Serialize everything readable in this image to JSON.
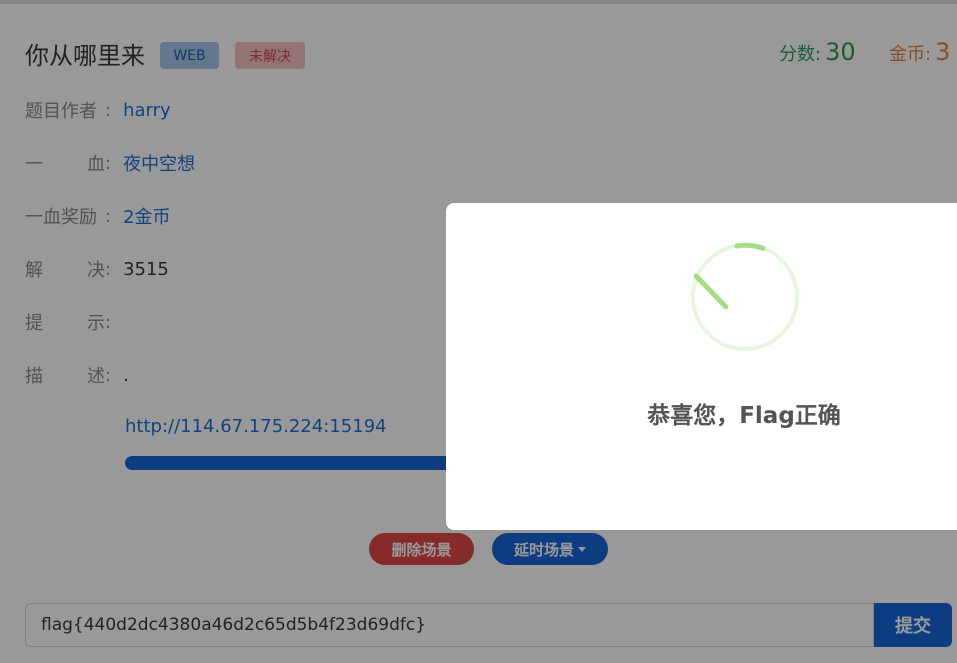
{
  "challenge": {
    "title": "你从哪里来",
    "category_badge": "WEB",
    "status_badge": "未解决"
  },
  "stats": {
    "score_label": "分数:",
    "score_value": "30",
    "coins_label": "金币:",
    "coins_value": "3"
  },
  "details": [
    {
      "label_a": "题目作者",
      "label_b": "",
      "colon": ":",
      "value": "harry"
    },
    {
      "label_a": "一",
      "label_b": "血",
      "colon": ":",
      "value": "夜中空想"
    },
    {
      "label_a": "一血奖励",
      "label_b": "",
      "colon": ":",
      "value": "2金币"
    },
    {
      "label_a": "解",
      "label_b": "决",
      "colon": ":",
      "value": "3515"
    },
    {
      "label_a": "提",
      "label_b": "示",
      "colon": ":",
      "value": ""
    },
    {
      "label_a": "描",
      "label_b": "述",
      "colon": ":",
      "value": "."
    }
  ],
  "scene": {
    "url": "http://114.67.175.224:15194",
    "progress_percent": 100,
    "delete_button": "删除场景",
    "delay_button": "延时场景"
  },
  "flag_form": {
    "value": "flag{440d2dc4380a46d2c65d5b4f23d69dfc}",
    "submit_label": "提交"
  },
  "modal": {
    "message": "恭喜您，Flag正确",
    "icon": "success-spinner-icon"
  },
  "colors": {
    "primary": "#1665d8",
    "success": "#2c9c53",
    "coins": "#e2833a",
    "danger": "#e04747",
    "spinner": "#a5dc86"
  }
}
